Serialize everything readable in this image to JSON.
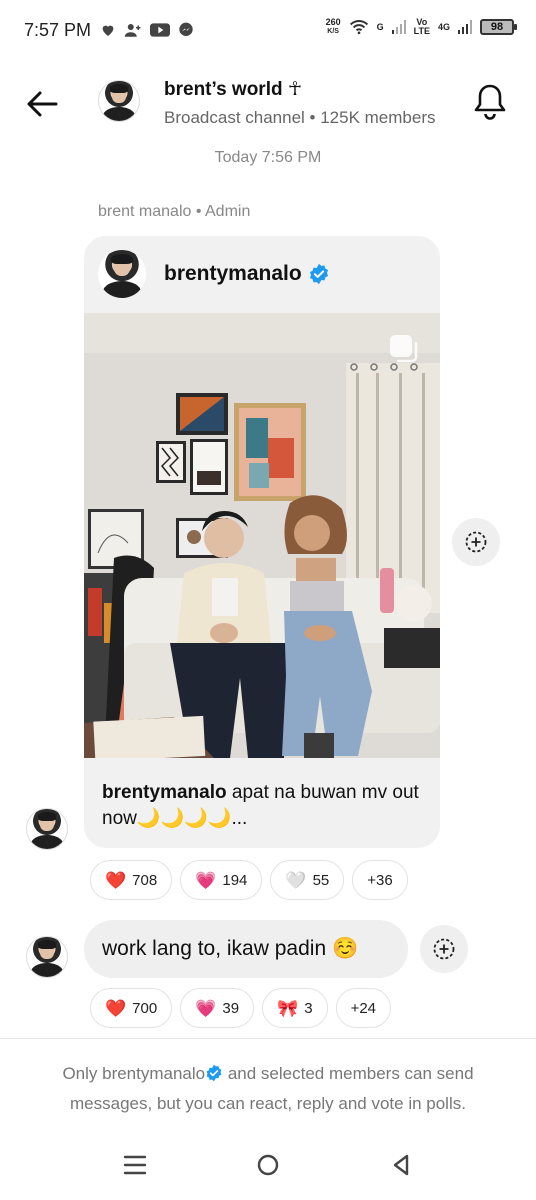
{
  "status_bar": {
    "time": "7:57 PM",
    "speed_value": "260",
    "speed_unit": "K/S",
    "network_g": "G",
    "volte_top": "Vo",
    "volte_bottom": "LTE",
    "network_4g": "4G",
    "battery": "98"
  },
  "header": {
    "title": "brent’s world ☥",
    "subtitle": "Broadcast channel • 125K members"
  },
  "timestamp": "Today 7:56 PM",
  "sender_line": "brent manalo • Admin",
  "post": {
    "username": "brentymanalo",
    "caption_user": "brentymanalo",
    "caption_text": " apat na buwan mv out now🌙🌙🌙🌙..."
  },
  "post_reactions": [
    {
      "emoji": "❤️",
      "count": "708"
    },
    {
      "emoji": "💗",
      "count": "194"
    },
    {
      "emoji": "🤍",
      "count": "55"
    },
    {
      "emoji": "",
      "count": "+36"
    }
  ],
  "message": {
    "text": "work lang to, ikaw padin ☺️"
  },
  "message_reactions": [
    {
      "emoji": "❤️",
      "count": "700"
    },
    {
      "emoji": "💗",
      "count": "39"
    },
    {
      "emoji": "🎀",
      "count": "3"
    },
    {
      "emoji": "",
      "count": "+24"
    }
  ],
  "footer": {
    "prefix": "Only brentymanalo",
    "suffix": " and selected members can send messages, but you can react, reply and vote in polls."
  },
  "icons": {
    "back": "arrow-left-icon",
    "bell": "bell-icon",
    "verified": "verified-badge-icon",
    "add_reaction": "add-reaction-icon",
    "multi_photo": "carousel-icon"
  },
  "colors": {
    "verified_blue": "#1d9bf0",
    "text_secondary": "#888888",
    "bubble_bg": "#efefef"
  }
}
